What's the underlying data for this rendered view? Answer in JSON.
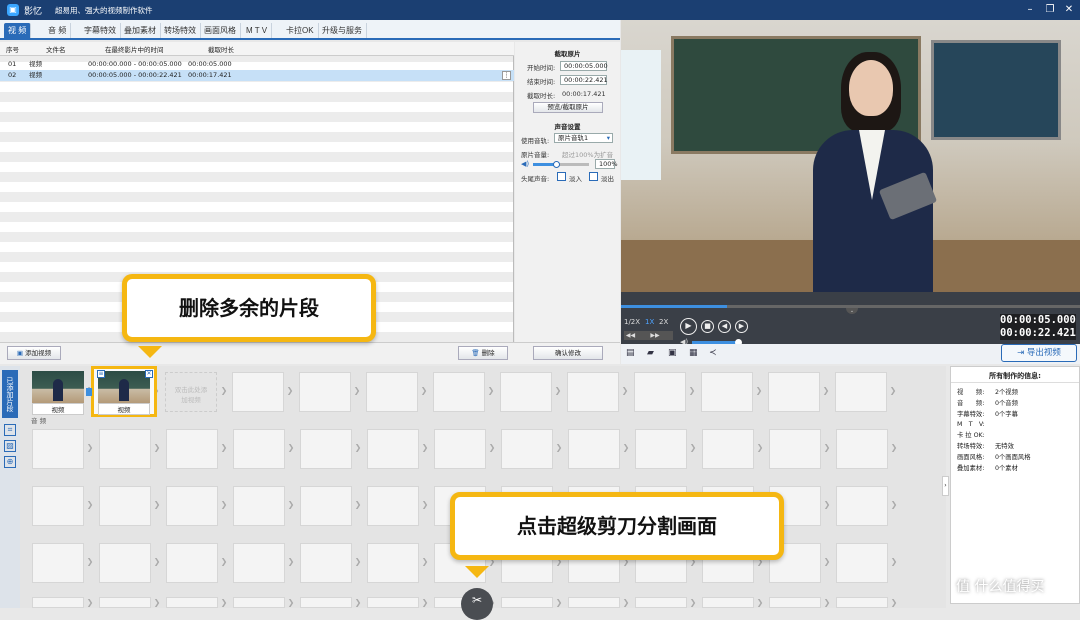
{
  "app": {
    "name": "影忆",
    "slogan": "超易用、强大的视频制作软件"
  },
  "tabs": [
    "视 频",
    "音 频",
    "字幕特效",
    "叠加素材",
    "转场特效",
    "画面风格",
    "M T V",
    "卡拉OK",
    "升级与服务"
  ],
  "table": {
    "headers": [
      "序号",
      "文件名",
      "在最终影片中的时间",
      "截取时长"
    ],
    "rows": [
      {
        "no": "01",
        "name": "视频",
        "time": "00:00:00.000 - 00:00:05.000",
        "dur": "00:00:05.000"
      },
      {
        "no": "02",
        "name": "视频",
        "time": "00:00:05.000 - 00:00:22.421",
        "dur": "00:00:17.421"
      }
    ]
  },
  "clip": {
    "title": "截取原片",
    "start_label": "开始时间:",
    "start": "00:00:05.000",
    "end_label": "结束时间:",
    "end": "00:00:22.421",
    "dur_label": "截取时长:",
    "dur": "00:00:17.421",
    "preview_btn": "预览/截取原片"
  },
  "audio": {
    "title": "声音设置",
    "track_label": "使用音轨:",
    "track": "原片音轨1",
    "vol_label": "原片音量:",
    "vol_hint": "超过100%为扩音",
    "vol": "100%",
    "fade_label": "头尾声音:",
    "fade_in": "淡入",
    "fade_out": "淡出"
  },
  "confirm_btn": "确认修改",
  "add_video": "添加视频",
  "delete": "删除",
  "player": {
    "speeds": [
      "1/2X",
      "1X",
      "2X"
    ],
    "time_current": "00:00:05.000",
    "time_total": "00:00:22.421",
    "progress": 0.23
  },
  "export_btn": "导出视频",
  "timeline": {
    "side_label": "已添加片段",
    "clips": [
      "视频",
      "视频"
    ],
    "placeholder": "双击此处添加视频",
    "audio_label": "音 频"
  },
  "info": {
    "title": "所有制作的信息:",
    "rows": [
      {
        "k": "视　　频:",
        "v": "2个视频"
      },
      {
        "k": "音　　频:",
        "v": "0个音频"
      },
      {
        "k": "字幕特效:",
        "v": "0个字幕"
      },
      {
        "k": "M　T　V:",
        "v": ""
      },
      {
        "k": "卡 拉 OK:",
        "v": ""
      },
      {
        "k": "转场特效:",
        "v": "无特效"
      },
      {
        "k": "画面风格:",
        "v": "0个画面风格"
      },
      {
        "k": "叠加素材:",
        "v": "0个素材"
      }
    ]
  },
  "callouts": {
    "top": "删除多余的片段",
    "bottom": "点击超级剪刀分割画面"
  },
  "watermark": "什么值得买",
  "colors": {
    "accent": "#2a6bb8",
    "callout": "#f5b712",
    "titlebar": "#1b3f72"
  }
}
